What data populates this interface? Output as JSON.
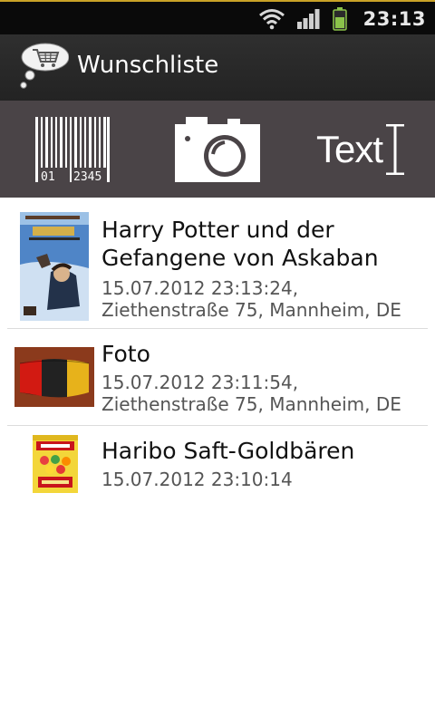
{
  "status_bar": {
    "time": "23:13",
    "icons": [
      "wifi-icon",
      "signal-icon",
      "battery-icon"
    ],
    "battery_color": "#8bc34a"
  },
  "app": {
    "title": "Wunschliste",
    "icon": "shopping-cart-thought-bubble-icon"
  },
  "actions": {
    "barcode_digits_left": "01",
    "barcode_digits_right": "2345",
    "camera": "camera-icon",
    "text_label": "Text"
  },
  "items": [
    {
      "title": "Harry Potter und der Gefangene von Askaban",
      "meta": "15.07.2012 23:13:24, Ziethenstraße 75, Mannheim, DE",
      "thumbnail": "book-cover"
    },
    {
      "title": "Foto",
      "meta": "15.07.2012 23:11:54, Ziethenstraße 75, Mannheim, DE",
      "thumbnail": "photo"
    },
    {
      "title": "Haribo Saft-Goldbären",
      "meta": "15.07.2012 23:10:14",
      "thumbnail": "product-bag"
    }
  ],
  "colors": {
    "accent": "#c9a227",
    "action_bar": "#4a4447",
    "title_bar": "#2a2a2a"
  }
}
